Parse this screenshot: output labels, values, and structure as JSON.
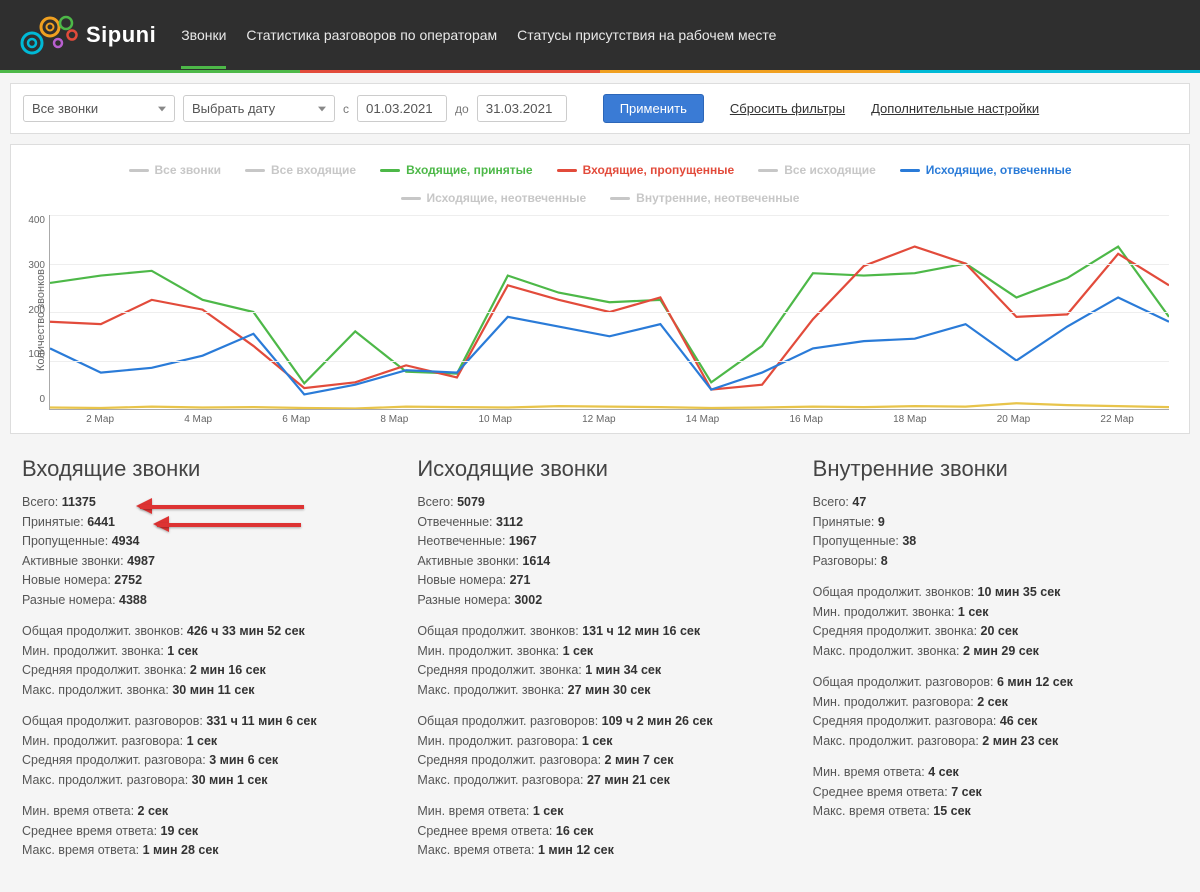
{
  "brand": "Sipuni",
  "nav": {
    "calls": "Звонки",
    "stats": "Статистика разговоров по операторам",
    "presence": "Статусы присутствия на рабочем месте"
  },
  "filters": {
    "all_calls": "Все звонки",
    "pick_date": "Выбрать дату",
    "from_lbl": "с",
    "to_lbl": "до",
    "from": "01.03.2021",
    "to": "31.03.2021",
    "apply": "Применить",
    "reset": "Сбросить фильтры",
    "extra": "Дополнительные настройки"
  },
  "legend": [
    {
      "label": "Все звонки",
      "color": "#c7c7c7"
    },
    {
      "label": "Все входящие",
      "color": "#c7c7c7"
    },
    {
      "label": "Входящие, принятые",
      "color": "#4db848"
    },
    {
      "label": "Входящие, пропущенные",
      "color": "#e24b3b"
    },
    {
      "label": "Все исходящие",
      "color": "#c7c7c7"
    },
    {
      "label": "Исходящие, отвеченные",
      "color": "#2a7bd8"
    },
    {
      "label": "Исходящие, неотвеченные",
      "color": "#c7c7c7"
    },
    {
      "label": "Внутренние, неотвеченные",
      "color": "#c7c7c7"
    }
  ],
  "chart_data": {
    "type": "line",
    "ylabel": "Количество звонков",
    "ylim": [
      0,
      400
    ],
    "yticks": [
      "400",
      "300",
      "200",
      "100",
      "0"
    ],
    "xticks": [
      "2 Мар",
      "4 Мар",
      "6 Мар",
      "8 Мар",
      "10 Мар",
      "12 Мар",
      "14 Мар",
      "16 Мар",
      "18 Мар",
      "20 Мар",
      "22 Мар"
    ],
    "x": [
      1,
      2,
      3,
      4,
      5,
      6,
      7,
      8,
      9,
      10,
      11,
      12,
      13,
      14,
      15,
      16,
      17,
      18,
      19,
      20,
      21,
      22,
      23
    ],
    "series": [
      {
        "name": "Входящие, принятые",
        "color": "#4db848",
        "values": [
          260,
          275,
          285,
          225,
          200,
          53,
          160,
          77,
          73,
          275,
          240,
          220,
          225,
          55,
          130,
          280,
          275,
          280,
          300,
          230,
          270,
          335,
          190
        ]
      },
      {
        "name": "Входящие, пропущенные",
        "color": "#e24b3b",
        "values": [
          180,
          175,
          225,
          205,
          130,
          43,
          55,
          90,
          65,
          255,
          225,
          200,
          230,
          40,
          50,
          185,
          295,
          335,
          300,
          190,
          195,
          320,
          255
        ]
      },
      {
        "name": "Исходящие, отвеченные",
        "color": "#2a7bd8",
        "values": [
          125,
          75,
          85,
          110,
          155,
          30,
          50,
          80,
          75,
          190,
          170,
          150,
          175,
          40,
          75,
          125,
          140,
          145,
          175,
          100,
          170,
          230,
          180
        ]
      },
      {
        "name": "Исходящие, неотвеченные",
        "color": "#e8c44a",
        "values": [
          3,
          2,
          5,
          3,
          4,
          2,
          1,
          5,
          4,
          3,
          6,
          5,
          4,
          2,
          3,
          5,
          4,
          6,
          5,
          12,
          8,
          6,
          4
        ]
      }
    ]
  },
  "stats": {
    "in": {
      "title": "Входящие звонки",
      "rows": [
        [
          "Всего:",
          "11375"
        ],
        [
          "Принятые:",
          "6441"
        ],
        [
          "Пропущенные:",
          "4934"
        ],
        [
          "Активные звонки:",
          "4987"
        ],
        [
          "Новые номера:",
          "2752"
        ],
        [
          "Разные номера:",
          "4388"
        ]
      ],
      "calldur": [
        [
          "Общая продолжит. звонков:",
          "426 ч 33 мин 52 сек"
        ],
        [
          "Мин. продолжит. звонка:",
          "1 сек"
        ],
        [
          "Средняя продолжит. звонка:",
          "2 мин 16 сек"
        ],
        [
          "Макс. продолжит. звонка:",
          "30 мин 11 сек"
        ]
      ],
      "talkdur": [
        [
          "Общая продолжит. разговоров:",
          "331 ч 11 мин 6 сек"
        ],
        [
          "Мин. продолжит. разговора:",
          "1 сек"
        ],
        [
          "Средняя продолжит. разговора:",
          "3 мин 6 сек"
        ],
        [
          "Макс. продолжит. разговора:",
          "30 мин 1 сек"
        ]
      ],
      "answer": [
        [
          "Мин. время ответа:",
          "2 сек"
        ],
        [
          "Среднее время ответа:",
          "19 сек"
        ],
        [
          "Макс. время ответа:",
          "1 мин 28 сек"
        ]
      ]
    },
    "out": {
      "title": "Исходящие звонки",
      "rows": [
        [
          "Всего:",
          "5079"
        ],
        [
          "Отвеченные:",
          "3112"
        ],
        [
          "Неотвеченные:",
          "1967"
        ],
        [
          "Активные звонки:",
          "1614"
        ],
        [
          "Новые номера:",
          "271"
        ],
        [
          "Разные номера:",
          "3002"
        ]
      ],
      "calldur": [
        [
          "Общая продолжит. звонков:",
          "131 ч 12 мин 16 сек"
        ],
        [
          "Мин. продолжит. звонка:",
          "1 сек"
        ],
        [
          "Средняя продолжит. звонка:",
          "1 мин 34 сек"
        ],
        [
          "Макс. продолжит. звонка:",
          "27 мин 30 сек"
        ]
      ],
      "talkdur": [
        [
          "Общая продолжит. разговоров:",
          "109 ч 2 мин 26 сек"
        ],
        [
          "Мин. продолжит. разговора:",
          "1 сек"
        ],
        [
          "Средняя продолжит. разговора:",
          "2 мин 7 сек"
        ],
        [
          "Макс. продолжит. разговора:",
          "27 мин 21 сек"
        ]
      ],
      "answer": [
        [
          "Мин. время ответа:",
          "1 сек"
        ],
        [
          "Среднее время ответа:",
          "16 сек"
        ],
        [
          "Макс. время ответа:",
          "1 мин 12 сек"
        ]
      ]
    },
    "int": {
      "title": "Внутренние звонки",
      "rows": [
        [
          "Всего:",
          "47"
        ],
        [
          "Принятые:",
          "9"
        ],
        [
          "Пропущенные:",
          "38"
        ],
        [
          "Разговоры:",
          "8"
        ]
      ],
      "calldur": [
        [
          "Общая продолжит. звонков:",
          "10 мин 35 сек"
        ],
        [
          "Мин. продолжит. звонка:",
          "1 сек"
        ],
        [
          "Средняя продолжит. звонка:",
          "20 сек"
        ],
        [
          "Макс. продолжит. звонка:",
          "2 мин 29 сек"
        ]
      ],
      "talkdur": [
        [
          "Общая продолжит. разговоров:",
          "6 мин 12 сек"
        ],
        [
          "Мин. продолжит. разговора:",
          "2 сек"
        ],
        [
          "Средняя продолжит. разговора:",
          "46 сек"
        ],
        [
          "Макс. продолжит. разговора:",
          "2 мин 23 сек"
        ]
      ],
      "answer": [
        [
          "Мин. время ответа:",
          "4 сек"
        ],
        [
          "Среднее время ответа:",
          "7 сек"
        ],
        [
          "Макс. время ответа:",
          "15 сек"
        ]
      ]
    }
  }
}
